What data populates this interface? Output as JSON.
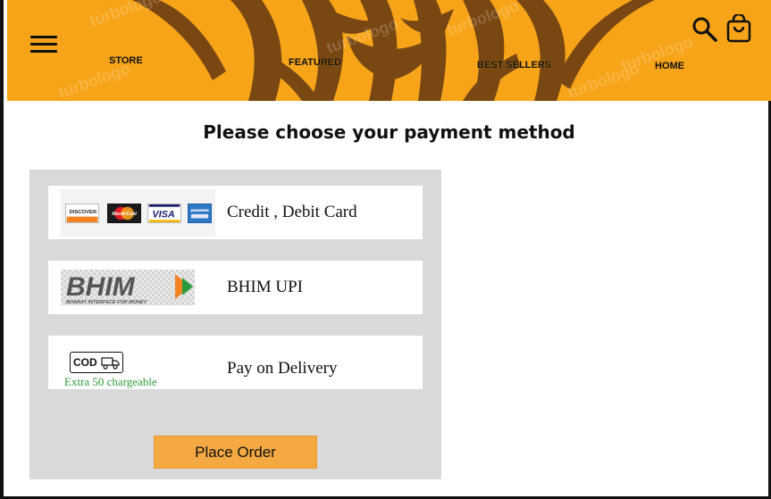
{
  "header": {
    "nav": {
      "store": "STORE",
      "featured": "FEATURED",
      "best_sellers": "BEST SELLERS",
      "home": "HOME"
    },
    "watermark": "turbologo",
    "icons": [
      "menu-icon",
      "search-icon",
      "shopping-bag-icon"
    ]
  },
  "page": {
    "title": "Please choose your payment method"
  },
  "payment_options": [
    {
      "label": "Credit , Debit Card",
      "logos": [
        "DISCOVER",
        "MasterCard",
        "VISA",
        "AMERICAN EXPRESS"
      ]
    },
    {
      "label": "BHIM UPI",
      "logo_text": "BHIM",
      "logo_subtext": "BHARAT INTERFACE FOR MONEY"
    },
    {
      "label": "Pay on Delivery",
      "badge": "COD",
      "note": "Extra  50 chargeable"
    }
  ],
  "actions": {
    "place_order": "Place Order"
  },
  "colors": {
    "header_bg": "#f7a418",
    "panel_bg": "#d9d9d9",
    "button_bg": "#f4a942",
    "note_green": "#2f9a3a"
  }
}
